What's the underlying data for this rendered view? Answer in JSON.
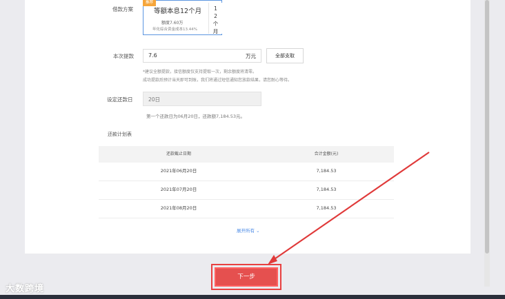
{
  "form": {
    "plan_label": "借款方案",
    "plan_card": {
      "badge": "推荐",
      "title": "等额本息12个月",
      "amount": "额度7.60万",
      "rate": "年化综合资金成本13.44%",
      "side_text": "12 个 月"
    },
    "withdraw_label": "本次提款",
    "withdraw_value": "7.6",
    "withdraw_unit": "万元",
    "withdraw_all_button": "全部支取",
    "note_line1": "*建议全额提款，接信额度仅支持提取一次，剩余额度将清零。",
    "note_line2": "成功提款后预计当天即可到账，我们将通过短信通知您放款结果，请您耐心等待。",
    "repay_day_label": "设定还款日",
    "repay_day_value": "20日",
    "repay_note": "第一个还款日为06月20日，还款额7,184.53元。"
  },
  "schedule": {
    "title": "还款计划表",
    "columns": [
      "还款截止日期",
      "合计金额(元)"
    ],
    "rows": [
      {
        "date": "2021年06月20日",
        "amount": "7,184.53"
      },
      {
        "date": "2021年07月20日",
        "amount": "7,184.53"
      },
      {
        "date": "2021年08月20日",
        "amount": "7,184.53"
      }
    ],
    "expand_label": "展开所有 ⌄"
  },
  "actions": {
    "next_button": "下一步"
  },
  "watermark": "大数跨境",
  "colors": {
    "accent_blue": "#4a8ae6",
    "primary_red": "#e5504f",
    "badge_orange": "#f5a53a"
  }
}
